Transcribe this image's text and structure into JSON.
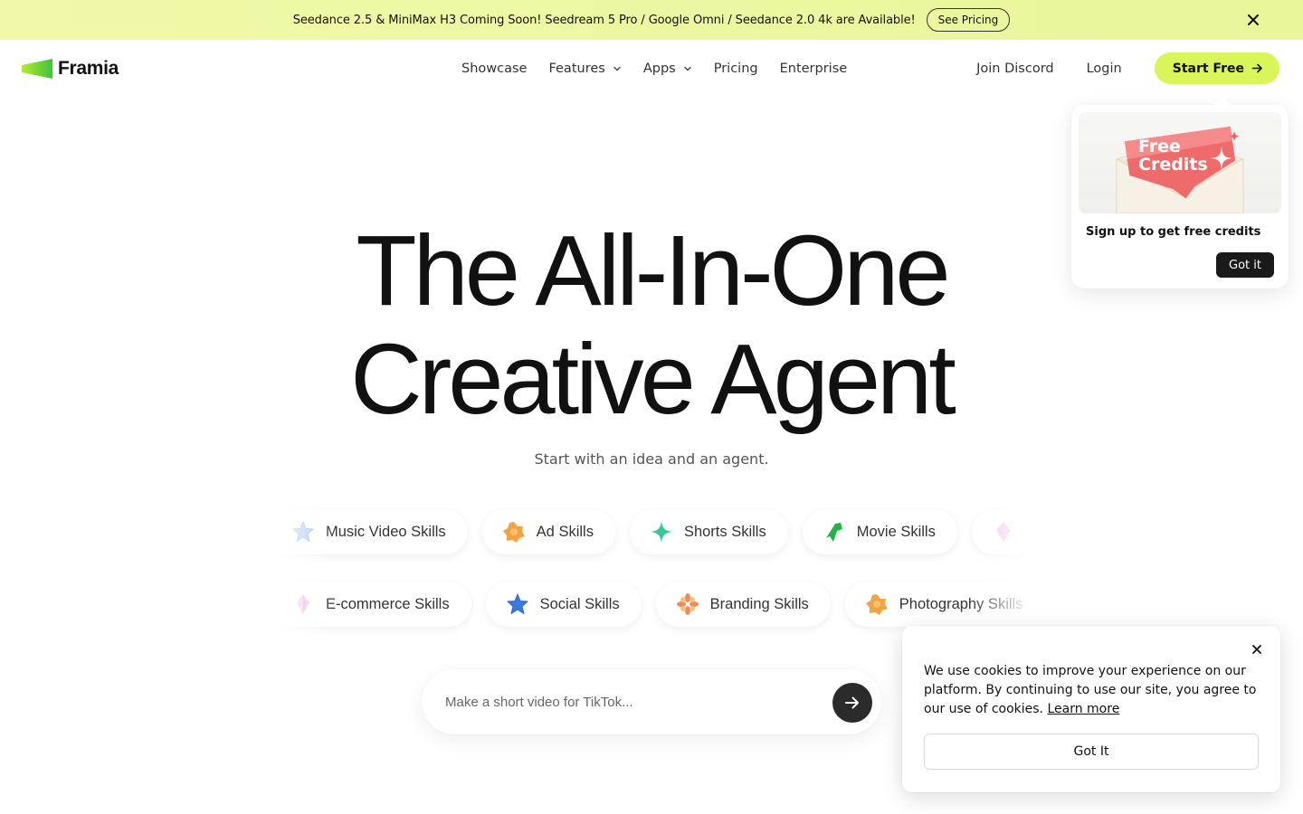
{
  "announcement": {
    "text": "Seedance 2.5 & MiniMax H3 Coming Soon! Seedream 5 Pro / Google Omni / Seedance 2.0 4k are Available!",
    "button_label": "See Pricing",
    "close_icon": "close-icon"
  },
  "header": {
    "logo_text": "Framia",
    "nav": [
      {
        "label": "Showcase"
      },
      {
        "label": "Features"
      },
      {
        "label": "Apps"
      },
      {
        "label": "Pricing"
      },
      {
        "label": "Enterprise"
      }
    ],
    "join_discord": "Join Discord",
    "login": "Login",
    "start_free": "Start Free"
  },
  "hero": {
    "title_line1": "The All-In-One",
    "title_line2": "Creative Agent",
    "subtitle": "Start with an idea and an agent."
  },
  "skills": {
    "row1": [
      {
        "label": "Music Video Skills",
        "icon": "star-icon",
        "color": "#9fc0f0"
      },
      {
        "label": "Ad Skills",
        "icon": "flower-icon",
        "color": "#f0a040"
      },
      {
        "label": "Shorts Skills",
        "icon": "sparkle-icon",
        "color": "#36c89a"
      },
      {
        "label": "Movie Skills",
        "icon": "arrow-icon",
        "color": "#22b24c"
      },
      {
        "label": "",
        "icon": "gem-icon",
        "color": "#f0b8e8"
      }
    ],
    "row2": [
      {
        "label": "E-commerce Skills",
        "icon": "gem-icon",
        "color": "#f0b8e8"
      },
      {
        "label": "Social Skills",
        "icon": "star-icon",
        "color": "#3a7ae0"
      },
      {
        "label": "Branding Skills",
        "icon": "burst-icon",
        "color": "#f08a5a"
      },
      {
        "label": "Photography Skills",
        "icon": "flower-icon",
        "color": "#f0a040"
      }
    ]
  },
  "prompt": {
    "placeholder": "Make a short video for TikTok...",
    "send_icon": "arrow-right-icon"
  },
  "credits_popover": {
    "image_line1": "Free",
    "image_line2": "Credits",
    "title": "Sign up to get free credits",
    "button": "Got it"
  },
  "cookie": {
    "text": "We use cookies to improve your experience on our platform. By continuing to use our site, you agree to our use of cookies.",
    "learn_more": "Learn more",
    "button": "Got It"
  },
  "colors": {
    "accent": "#d8f55a",
    "announce_bg": "#edf7a2",
    "dark": "#1a1a1a"
  }
}
